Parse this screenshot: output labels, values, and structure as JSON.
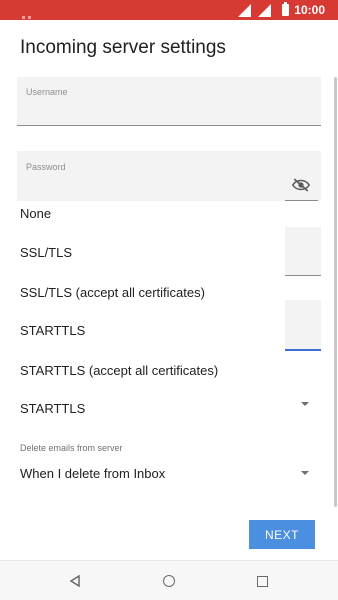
{
  "status_bar": {
    "time": "10:00"
  },
  "page": {
    "title": "Incoming server settings"
  },
  "username": {
    "label": "Username",
    "value": ""
  },
  "password": {
    "label": "Password",
    "value": ""
  },
  "security_options": [
    "None",
    "SSL/TLS",
    "SSL/TLS (accept all certificates)",
    "STARTTLS",
    "STARTTLS (accept all certificates)"
  ],
  "security_type": {
    "selected": "STARTTLS"
  },
  "delete_emails": {
    "label": "Delete emails from server",
    "selected": "When I delete from Inbox"
  },
  "next_button": {
    "label": "NEXT"
  },
  "colors": {
    "status_bar": "#d63a33",
    "accent": "#4a8fe0",
    "focus_underline": "#3f6fd6"
  }
}
